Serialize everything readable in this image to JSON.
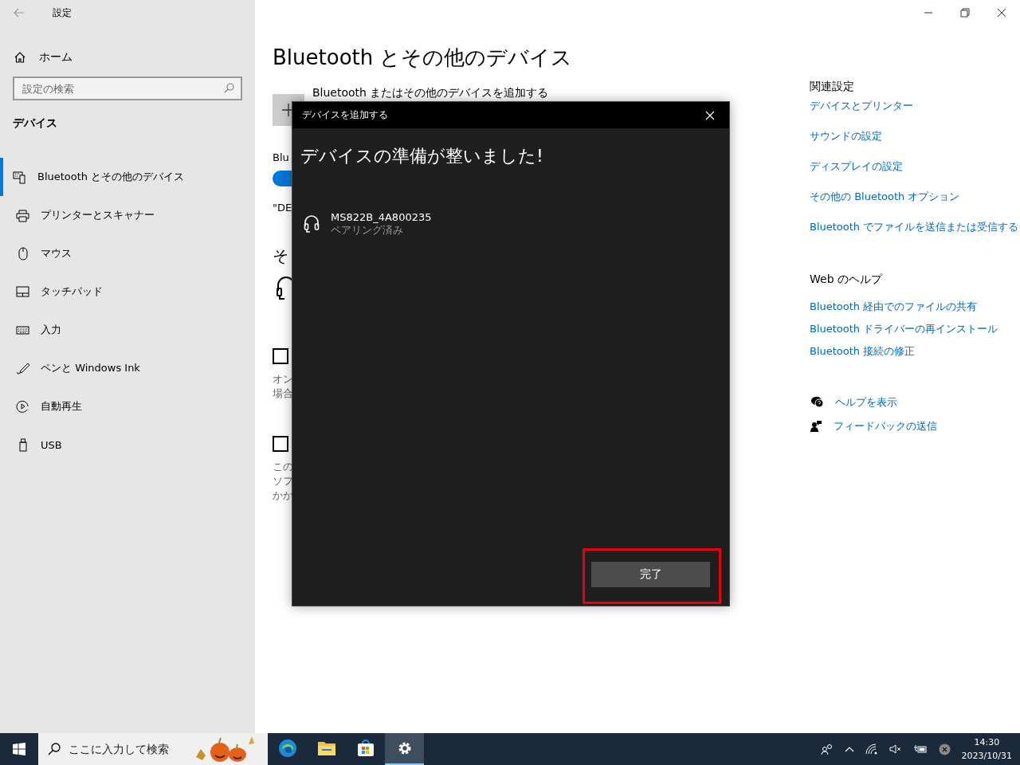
{
  "window": {
    "title": "設定"
  },
  "sidebar": {
    "home": "ホーム",
    "search": {
      "placeholder": "設定の検索"
    },
    "section": "デバイス",
    "items": [
      {
        "label": "Bluetooth とその他のデバイス",
        "selected": true
      },
      {
        "label": "プリンターとスキャナー",
        "selected": false
      },
      {
        "label": "マウス",
        "selected": false
      },
      {
        "label": "タッチパッド",
        "selected": false
      },
      {
        "label": "入力",
        "selected": false
      },
      {
        "label": "ペンと Windows Ink",
        "selected": false
      },
      {
        "label": "自動再生",
        "selected": false
      },
      {
        "label": "USB",
        "selected": false
      }
    ]
  },
  "main": {
    "title": "Bluetooth とその他のデバイス",
    "add_device": "Bluetooth またはその他のデバイスを追加する",
    "bluetooth_label": "Blu",
    "bluetooth_toggle": {
      "on": true
    },
    "discoverable_text": "\"DE",
    "other_heading": "そ",
    "checkboxes": [
      {
        "checked": false,
        "lines": [
          "オン",
          "場合"
        ]
      },
      {
        "checked": false,
        "lines": [
          "この",
          "ソフ",
          "かか"
        ]
      }
    ]
  },
  "dialog": {
    "title": "デバイスを追加する",
    "heading": "デバイスの準備が整いました!",
    "device": {
      "name": "MS822B_4A800235",
      "status": "ペアリング済み"
    },
    "done_button": "完了",
    "highlighted": true
  },
  "related": {
    "heading": "関連設定",
    "links": [
      "デバイスとプリンター",
      "サウンドの設定",
      "ディスプレイの設定",
      "その他の Bluetooth オプション",
      "Bluetooth でファイルを送信または受信する"
    ],
    "web_help_heading": "Web のヘルプ",
    "web_links": [
      "Bluetooth 経由でのファイルの共有",
      "Bluetooth ドライバーの再インストール",
      "Bluetooth 接続の修正"
    ],
    "help": "ヘルプを表示",
    "feedback": "フィードバックの送信"
  },
  "taskbar": {
    "search_placeholder": "ここに入力して検索",
    "apps": [
      {
        "selected": false
      },
      {
        "selected": false
      },
      {
        "selected": false
      },
      {
        "selected": true
      }
    ],
    "clock": {
      "time": "14:30",
      "date": "2023/10/31"
    }
  }
}
